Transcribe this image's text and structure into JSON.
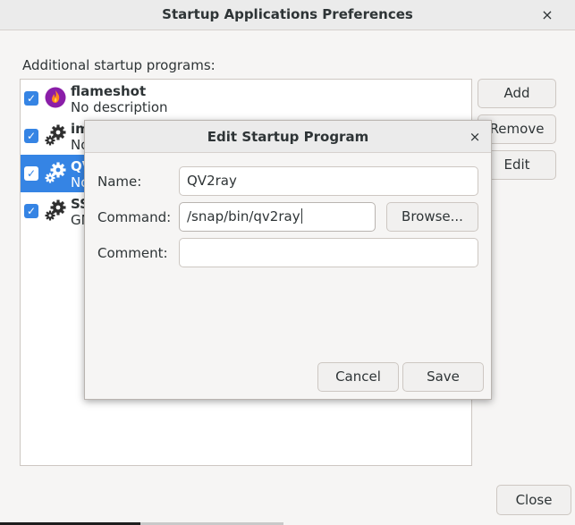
{
  "window": {
    "title": "Startup Applications Preferences",
    "close_glyph": "×",
    "section_label": "Additional startup programs:",
    "close_button": "Close"
  },
  "programs": [
    {
      "name": "flameshot",
      "description": "No description",
      "icon": "flameshot-icon",
      "checked": true
    },
    {
      "name": "im",
      "description": "No",
      "icon": "gear-icon",
      "checked": true
    },
    {
      "name": "QV",
      "description": "No",
      "icon": "gear-icon",
      "checked": true,
      "selected": true
    },
    {
      "name": "SS",
      "description": "GN",
      "icon": "gear-icon",
      "checked": true
    }
  ],
  "side_buttons": {
    "add": "Add",
    "remove": "Remove",
    "edit": "Edit"
  },
  "dialog": {
    "title": "Edit Startup Program",
    "close_glyph": "×",
    "name_label": "Name:",
    "name_value": "QV2ray",
    "command_label": "Command:",
    "command_value": "/snap/bin/qv2ray",
    "browse_button": "Browse...",
    "comment_label": "Comment:",
    "comment_value": "",
    "cancel_button": "Cancel",
    "save_button": "Save"
  },
  "colors": {
    "accent": "#3584e4",
    "background": "#f6f5f4"
  }
}
